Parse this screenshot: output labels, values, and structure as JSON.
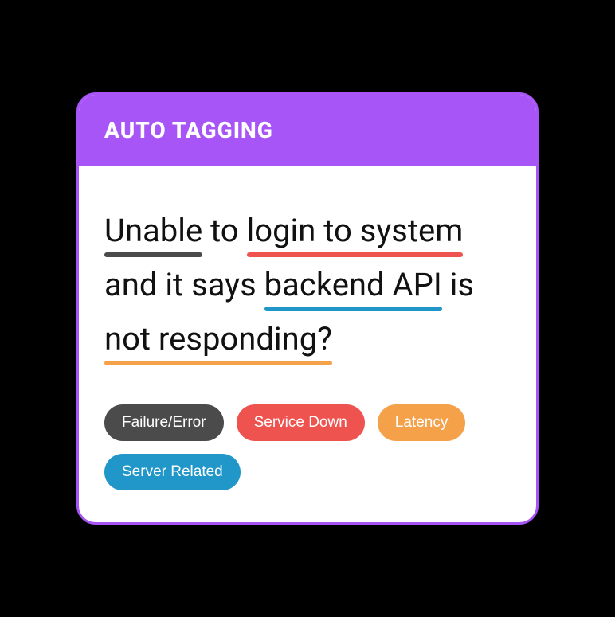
{
  "header": {
    "title": "AUTO TAGGING"
  },
  "message": {
    "segments": [
      {
        "text": "Unable",
        "style": "dark"
      },
      {
        "text": " to ",
        "style": "plain"
      },
      {
        "text": "login to system",
        "style": "red"
      },
      {
        "text": " and it says ",
        "style": "plain"
      },
      {
        "text": "backend API",
        "style": "blue"
      },
      {
        "text": " is ",
        "style": "plain"
      },
      {
        "text": "not responding?",
        "style": "orange"
      }
    ],
    "full_text": "Unable to login to system and it says backend API is not responding?"
  },
  "tags": [
    {
      "label": "Failure/Error",
      "color": "dark"
    },
    {
      "label": "Service Down",
      "color": "red"
    },
    {
      "label": "Latency",
      "color": "orange"
    },
    {
      "label": "Server Related",
      "color": "blue"
    }
  ],
  "colors": {
    "accent": "#a855f7",
    "dark": "#4b4b4b",
    "red": "#ef5350",
    "orange": "#f5a14a",
    "blue": "#2196c9"
  }
}
